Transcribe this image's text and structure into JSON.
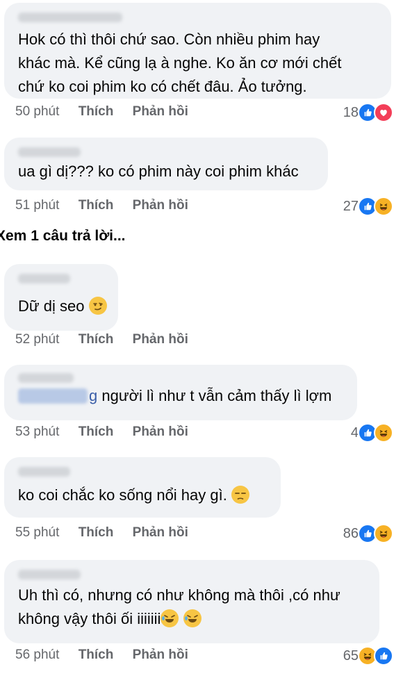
{
  "comments": [
    {
      "text_lines": [
        "Hok có thì thôi chứ sao. Còn nhiều phim hay",
        "khác mà. Kể cũng lạ à nghe. Ko ăn cơ mới chết",
        "chứ ko coi phim ko có chết đâu. Ảo tưởng."
      ],
      "time": "50 phút",
      "like": "Thích",
      "reply": "Phản hồi",
      "reaction_count": "18",
      "reactions": [
        "like-icon",
        "love-icon"
      ]
    },
    {
      "text": "ua gì dị??? ko có phim này coi phim khác",
      "time": "51 phút",
      "like": "Thích",
      "reply": "Phản hồi",
      "reaction_count": "27",
      "reactions": [
        "like-icon",
        "haha-icon"
      ]
    },
    {
      "text": "Dữ dị seo",
      "time": "52 phút",
      "like": "Thích",
      "reply": "Phản hồi"
    },
    {
      "mention_tail": "g",
      "text": "người lì như t vẫn cảm thấy lì lợm",
      "time": "53 phút",
      "like": "Thích",
      "reply": "Phản hồi",
      "reaction_count": "4",
      "reactions": [
        "like-icon",
        "haha-icon"
      ]
    },
    {
      "text": "ko coi chắc ko sống nổi hay gì.",
      "time": "55 phút",
      "like": "Thích",
      "reply": "Phản hồi",
      "reaction_count": "86",
      "reactions": [
        "like-icon",
        "haha-icon"
      ]
    },
    {
      "text_lines": [
        "Uh thì có, nhưng có như không mà thôi ,có như",
        "không vậy thôi ối iiiiiii"
      ],
      "time": "56 phút",
      "like": "Thích",
      "reply": "Phản hồi",
      "reaction_count": "65",
      "reactions": [
        "haha-icon",
        "like-icon"
      ]
    }
  ],
  "view_more": "Xem 1 câu trả lời...",
  "colors": {
    "bubble": "#f0f2f5",
    "meta": "#65676b",
    "like": "#1877f2",
    "love": "#f33e58",
    "haha": "#f7b125"
  }
}
